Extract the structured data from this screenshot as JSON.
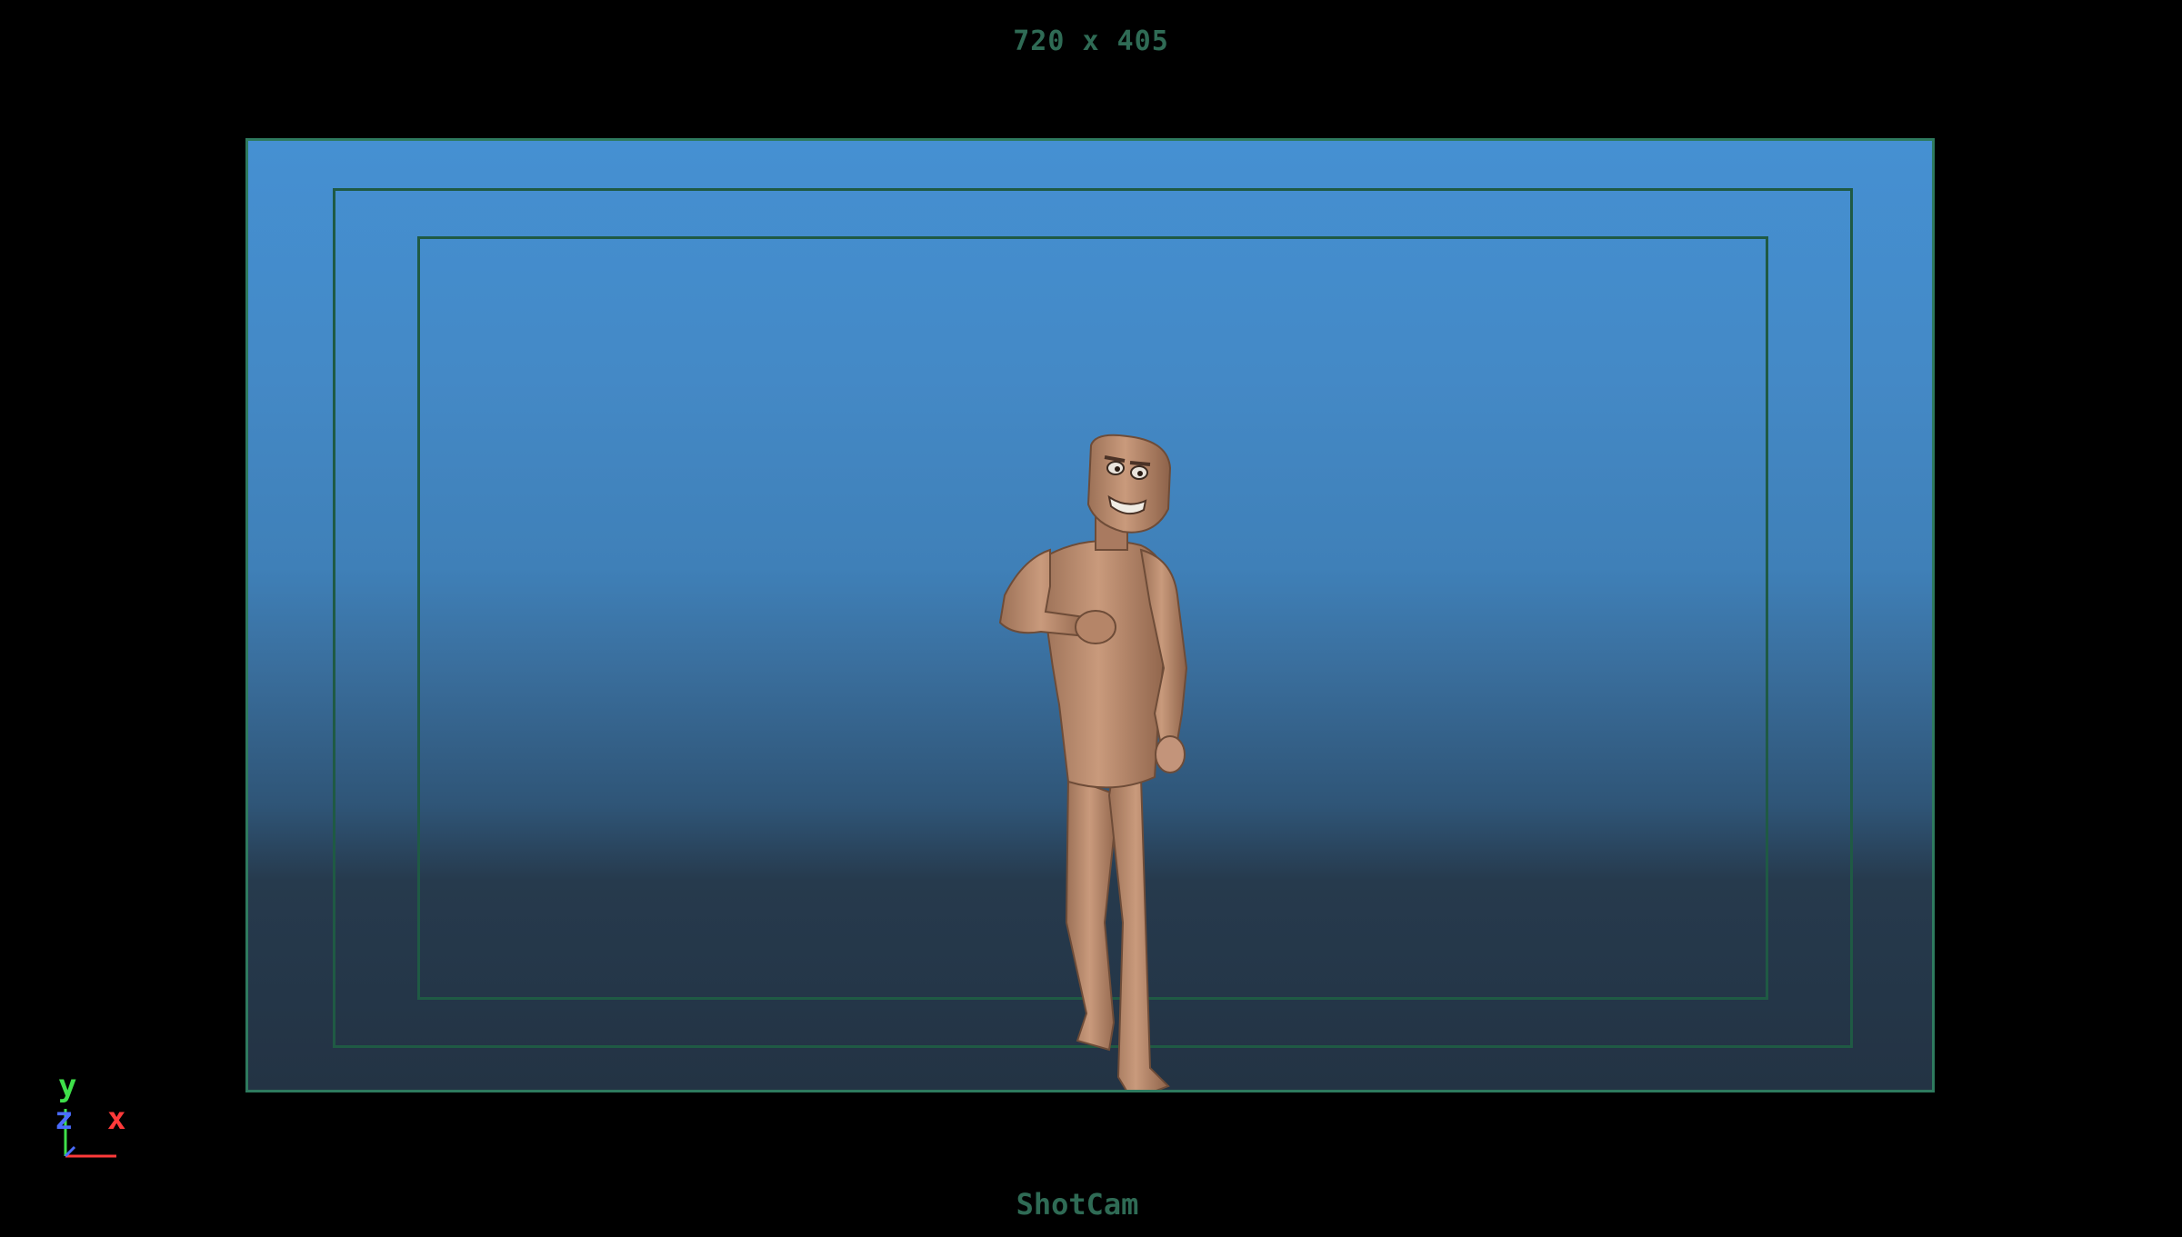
{
  "viewport": {
    "resolution_label": "720 x 405",
    "camera_name": "ShotCam"
  },
  "axis_gizmo": {
    "y_label": "y",
    "z_label": "z",
    "x_label": "x"
  },
  "colors": {
    "hud_text": "#2f6b55",
    "gate_border": "#2e7a5e",
    "safe_frame_border": "#1f5a44",
    "background_top": "#4590d2",
    "background_bottom": "#233344",
    "axis_x": "#ff3a3a",
    "axis_y": "#3fe04a",
    "axis_z": "#4a6cff"
  }
}
